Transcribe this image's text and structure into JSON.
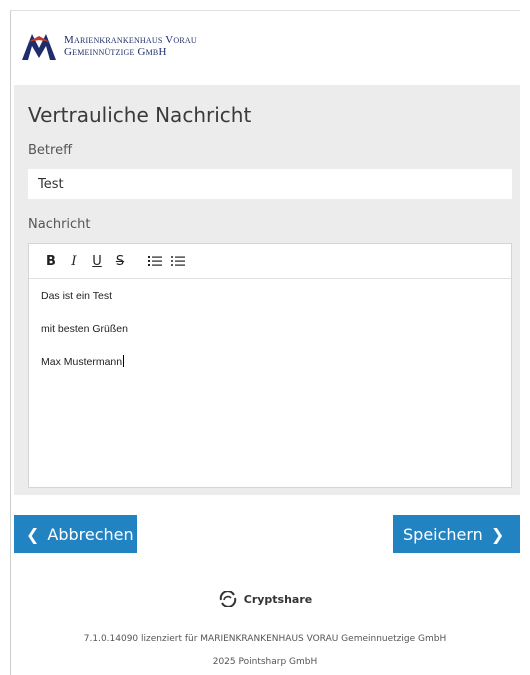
{
  "header": {
    "logo_line1": "Marienkrankenhaus Vorau",
    "logo_line2": "Gemeinnützige GmbH"
  },
  "form": {
    "title": "Vertrauliche Nachricht",
    "subject_label": "Betreff",
    "subject_value": "Test",
    "message_label": "Nachricht",
    "toolbar": {
      "bold": "B",
      "italic": "I",
      "underline": "U",
      "strike": "S"
    },
    "message_lines": [
      "Das ist ein Test",
      "mit besten Grüßen",
      "Max Mustermann"
    ]
  },
  "actions": {
    "cancel_label": "Abbrechen",
    "save_label": "Speichern"
  },
  "footer": {
    "brand": "Cryptshare",
    "license": "7.1.0.14090 lizenziert für MARIENKRANKENHAUS VORAU Gemeinnuetzige GmbH",
    "copyright": "2025 Pointsharp GmbH"
  },
  "colors": {
    "accent": "#2283c3",
    "panel": "#ececec",
    "logo": "#1f2e6b"
  }
}
